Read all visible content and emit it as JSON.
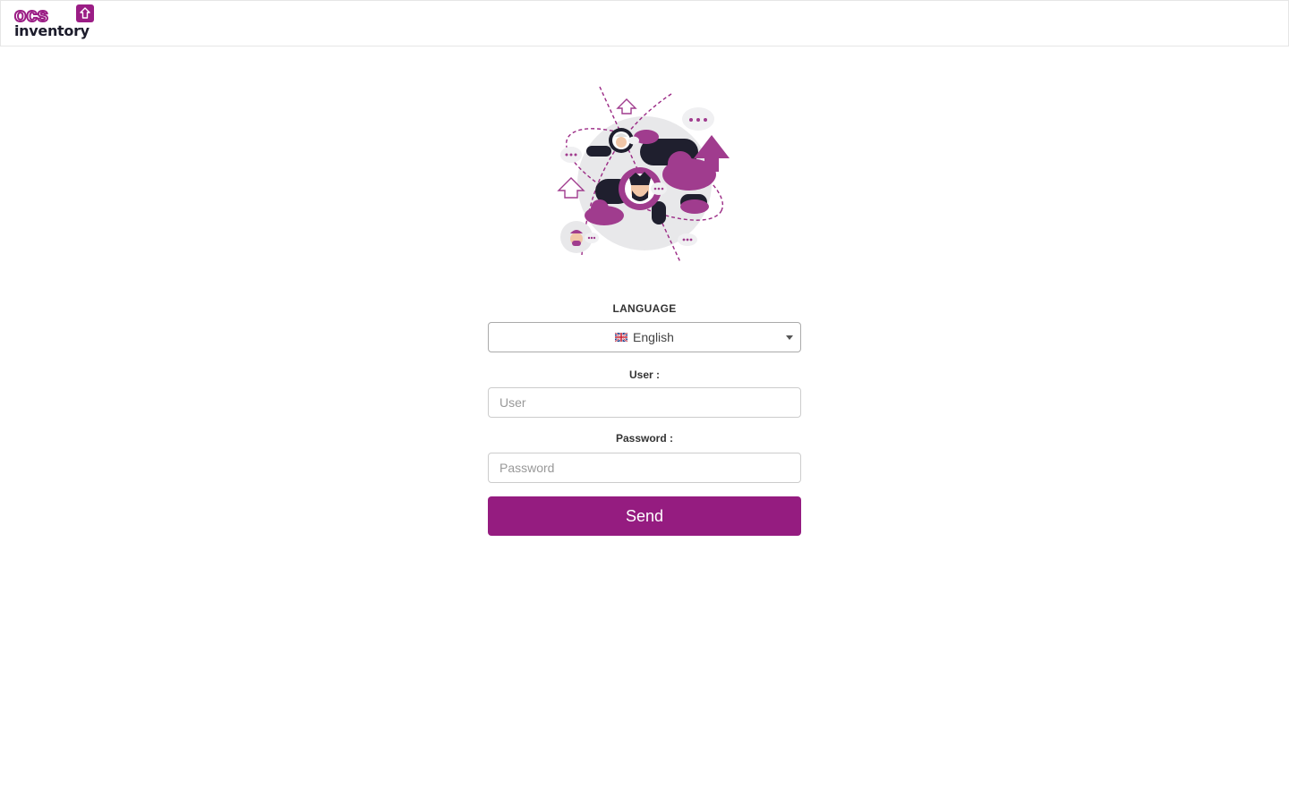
{
  "brand": {
    "logo_top": "ocs",
    "logo_bottom": "inventory",
    "accent_color": "#951c80",
    "dark_color": "#1c1c2b"
  },
  "login": {
    "language_label": "LANGUAGE",
    "language_selected": "English",
    "language_flag_icon": "uk-flag-icon",
    "user_label": "User :",
    "user_placeholder": "User",
    "user_value": "",
    "password_label": "Password :",
    "password_placeholder": "Password",
    "password_value": "",
    "send_label": "Send"
  }
}
